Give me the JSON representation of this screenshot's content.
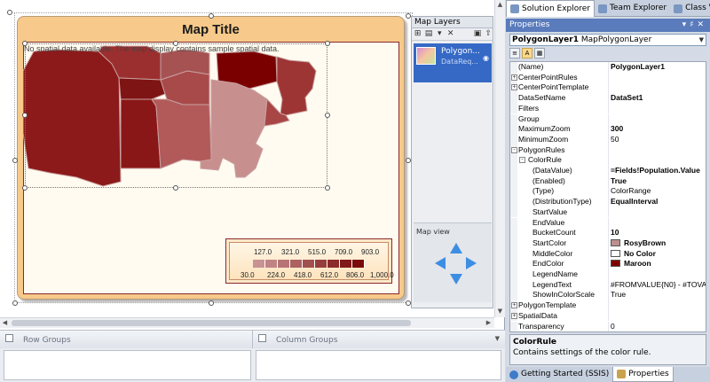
{
  "map": {
    "title": "Map Title",
    "message": "No spatial data available. The map display contains sample spatial data.",
    "colors": {
      "frame": "#f7c98a",
      "maroon": "#8b0000"
    }
  },
  "legend": {
    "top_labels": [
      "127.0",
      "321.0",
      "515.0",
      "709.0",
      "903.0"
    ],
    "bottom_labels": [
      "30.0",
      "224.0",
      "418.0",
      "612.0",
      "806.0",
      "1,000.0"
    ]
  },
  "map_layers": {
    "title": "Map Layers",
    "layer_name": "Polygon...",
    "layer_sub": "DataReq...",
    "map_view_label": "Map view"
  },
  "grouping": {
    "row_groups": "Row Groups",
    "column_groups": "Column Groups"
  },
  "tabs": {
    "solution_explorer": "Solution Explorer",
    "team_explorer": "Team Explorer",
    "class_view": "Class View"
  },
  "properties": {
    "header": "Properties",
    "object_name": "PolygonLayer1",
    "object_type": "MapPolygonLayer",
    "rows": [
      {
        "name": "(Name)",
        "value": "PolygonLayer1"
      },
      {
        "name": "CenterPointRules",
        "value": ""
      },
      {
        "name": "CenterPointTemplate",
        "value": ""
      },
      {
        "name": "DataSetName",
        "value": "DataSet1"
      },
      {
        "name": "Filters",
        "value": ""
      },
      {
        "name": "Group",
        "value": ""
      },
      {
        "name": "MaximumZoom",
        "value": "300"
      },
      {
        "name": "MinimumZoom",
        "value": "50"
      },
      {
        "name": "PolygonRules",
        "value": ""
      },
      {
        "name": "ColorRule",
        "value": ""
      },
      {
        "name": "(DataValue)",
        "value": "=Fields!Population.Value"
      },
      {
        "name": "(Enabled)",
        "value": "True"
      },
      {
        "name": "(Type)",
        "value": "ColorRange"
      },
      {
        "name": "(DistributionType)",
        "value": "EqualInterval"
      },
      {
        "name": "StartValue",
        "value": ""
      },
      {
        "name": "EndValue",
        "value": ""
      },
      {
        "name": "BucketCount",
        "value": "10"
      },
      {
        "name": "StartColor",
        "value": "RosyBrown"
      },
      {
        "name": "MiddleColor",
        "value": "No Color"
      },
      {
        "name": "EndColor",
        "value": "Maroon"
      },
      {
        "name": "LegendName",
        "value": ""
      },
      {
        "name": "LegendText",
        "value": "#FROMVALUE{N0} - #TOVALUE"
      },
      {
        "name": "ShowInColorScale",
        "value": "True"
      },
      {
        "name": "PolygonTemplate",
        "value": ""
      },
      {
        "name": "SpatialData",
        "value": ""
      },
      {
        "name": "Transparency",
        "value": "0"
      },
      {
        "name": "VisibilityMode",
        "value": "Visible"
      }
    ],
    "description_title": "ColorRule",
    "description_text": "Contains settings of the color rule.",
    "swatch_colors": {
      "start": "#bc8f8f",
      "middle": "#ffffff",
      "end": "#800000"
    }
  },
  "bottom_tabs": {
    "getting_started": "Getting Started (SSIS)",
    "properties": "Properties"
  }
}
